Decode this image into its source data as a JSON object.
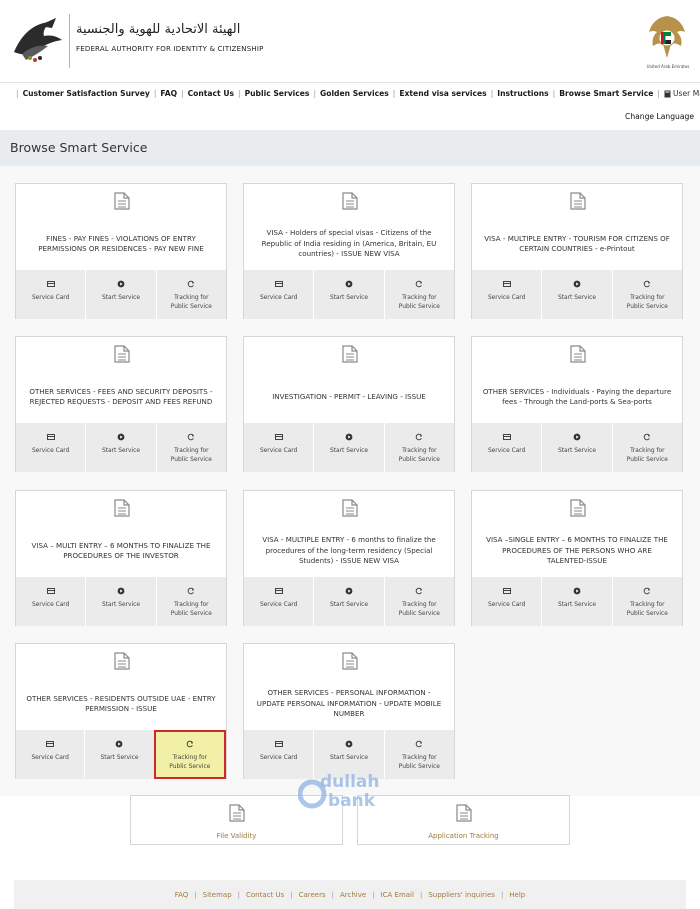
{
  "header": {
    "logo_ar": "الهيئة الاتحادية للهوية والجنسية",
    "logo_en": "FEDERAL AUTHORITY FOR IDENTITY & CITIZENSHIP",
    "emblem_caption": "United Arab Emirates",
    "logo_icon": "falcon-logo-icon",
    "emblem_icon": "uae-emblem-icon"
  },
  "nav": {
    "home_icon": "home-icon",
    "items": [
      "Customer Satisfaction Survey",
      "FAQ",
      "Contact Us",
      "Public Services",
      "Golden Services",
      "Extend visa services",
      "Instructions",
      "Browse Smart Service"
    ],
    "user_manual": "User Manual",
    "change_language": "Change Language"
  },
  "page": {
    "title": "Browse Smart Service"
  },
  "actions": {
    "service_card": "Service Card",
    "start_service": "Start Service",
    "tracking_1": "Tracking for",
    "tracking_2": "Public Service"
  },
  "cards": [
    "FINES - PAY FINES - VIOLATIONS OF ENTRY PERMISSIONS OR RESIDENCES - PAY NEW FINE",
    "VISA - Holders of special visas - Citizens of the Republic of India residing in (America, Britain, EU countries) - ISSUE NEW VISA",
    "VISA - MULTIPLE ENTRY - TOURISM FOR CITIZENS OF CERTAIN COUNTRIES - e-Printout",
    "OTHER SERVICES - FEES AND SECURITY DEPOSITS - REJECTED REQUESTS - DEPOSIT AND FEES REFUND",
    "INVESTIGATION - PERMIT - LEAVING - ISSUE",
    "OTHER SERVICES - Individuals - Paying the departure fees - Through the Land-ports & Sea-ports",
    "VISA – MULTI ENTRY – 6 MONTHS TO FINALIZE THE PROCEDURES OF THE INVESTOR",
    "VISA - MULTIPLE ENTRY - 6 months to finalize the procedures of the long-term residency (Special Students) - ISSUE NEW VISA",
    "VISA –SINGLE ENTRY – 6 MONTHS TO FINALIZE THE PROCEDURES OF THE PERSONS WHO ARE TALENTED-ISSUE",
    "OTHER SERVICES - RESIDENTS OUTSIDE UAE - ENTRY PERMISSION - ISSUE",
    "OTHER SERVICES - PERSONAL INFORMATION - UPDATE PERSONAL INFORMATION - UPDATE MOBILE NUMBER"
  ],
  "highlighted_card_index": 9,
  "bottom": {
    "file_validity": "File Validity",
    "application_tracking": "Application Tracking"
  },
  "watermark": {
    "line1": "dullah",
    "line2": "bank"
  },
  "footer": {
    "links": [
      "FAQ",
      "Sitemap",
      "Contact Us",
      "Careers",
      "Archive",
      "ICA Email",
      "Suppliers' inquiries",
      "Help"
    ]
  },
  "colors": {
    "accent_gold": "#a07a3c",
    "highlight_fill": "#f1f0a6",
    "highlight_border": "#d0282d",
    "band": "#e8ecee"
  }
}
